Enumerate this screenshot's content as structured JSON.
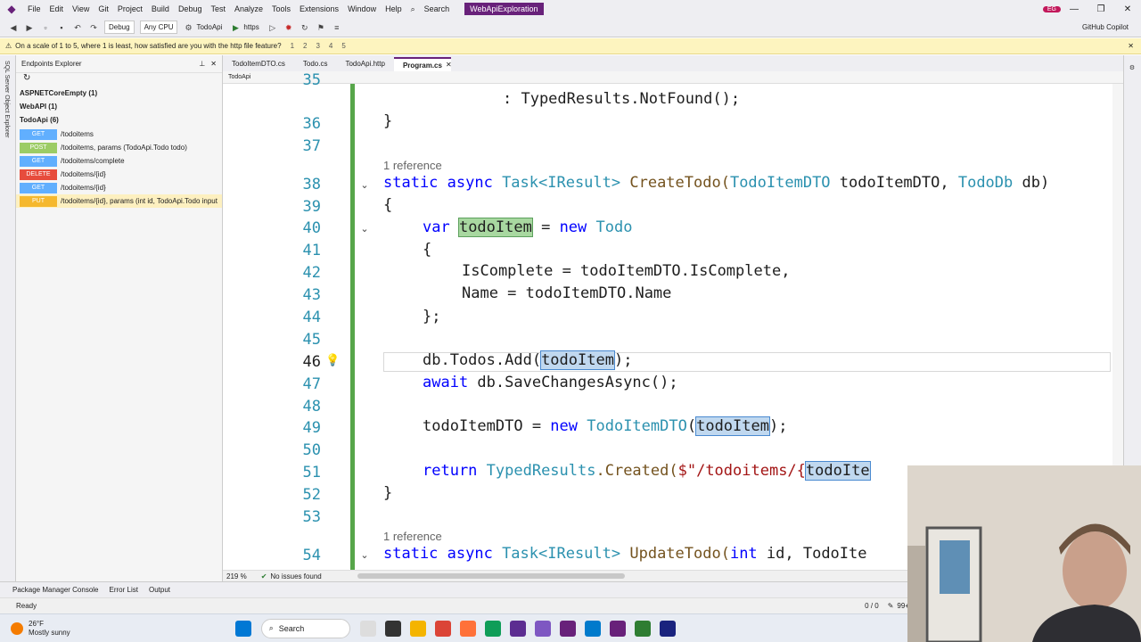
{
  "menu": {
    "items": [
      "File",
      "Edit",
      "View",
      "Git",
      "Project",
      "Build",
      "Debug",
      "Test",
      "Analyze",
      "Tools",
      "Extensions",
      "Window",
      "Help"
    ],
    "search": "Search",
    "solution_title": "WebApiExploration",
    "user_initials": "EG"
  },
  "toolbar": {
    "config": "Debug",
    "platform": "Any CPU",
    "startup_project": "TodoApi",
    "run_target": "https",
    "copilot": "GitHub Copilot"
  },
  "infobar": {
    "message": "On a scale of 1 to 5, where 1 is least, how satisfied are you with the http file feature?",
    "ratings": [
      "1",
      "2",
      "3",
      "4",
      "5"
    ]
  },
  "sidestrip": {
    "label": "SQL Server Object Explorer"
  },
  "explorer": {
    "title": "Endpoints Explorer",
    "groups": [
      "ASPNETCoreEmpty (1)",
      "WebAPI (1)",
      "TodoApi (6)"
    ],
    "endpoints": [
      {
        "verb": "GET",
        "path": "/todoitems"
      },
      {
        "verb": "POST",
        "path": "/todoitems, params (TodoApi.Todo todo)"
      },
      {
        "verb": "GET",
        "path": "/todoitems/complete"
      },
      {
        "verb": "DELETE",
        "path": "/todoitems/{id}"
      },
      {
        "verb": "GET",
        "path": "/todoitems/{id}"
      },
      {
        "verb": "PUT",
        "path": "/todoitems/{id}, params (int id, TodoApi.Todo input"
      }
    ]
  },
  "tabs": [
    "TodoItemDTO.cs",
    "Todo.cs",
    "TodoApi.http",
    "Program.cs"
  ],
  "active_tab": "Program.cs",
  "navbar": {
    "project": "TodoApi"
  },
  "editor": {
    "line_numbers": [
      "35",
      "36",
      "37",
      "38",
      "39",
      "40",
      "41",
      "42",
      "43",
      "44",
      "45",
      "46",
      "47",
      "48",
      "49",
      "50",
      "51",
      "52",
      "53",
      "54"
    ],
    "current_line": "46",
    "references": [
      "1 reference",
      "1 reference"
    ],
    "lines": {
      "l35": ": TypedResults.NotFound();",
      "l36": "}",
      "l38_kw": "static async ",
      "l38_type": "Task<IResult>",
      "l38_fn": " CreateTodo(",
      "l38_p1t": "TodoItemDTO",
      "l38_p1": " todoItemDTO, ",
      "l38_p2t": "TodoDb",
      "l38_p2": " db)",
      "l39": "{",
      "l40_kw": "var ",
      "l40_var": "todoItem",
      "l40_eq": " = ",
      "l40_new": "new ",
      "l40_type": "Todo",
      "l41": "{",
      "l42": "IsComplete = todoItemDTO.IsComplete,",
      "l43": "Name = todoItemDTO.Name",
      "l44": "};",
      "l46_pre": "db.Todos.Add(",
      "l46_var": "todoItem",
      "l46_post": ");",
      "l47_kw": "await ",
      "l47_rest": "db.SaveChangesAsync();",
      "l49_pre": "todoItemDTO = ",
      "l49_new": "new ",
      "l49_type": "TodoItemDTO",
      "l49_open": "(",
      "l49_var": "todoItem",
      "l49_post": ");",
      "l51_kw": "return ",
      "l51_type": "TypedResults",
      "l51_fn": ".Created(",
      "l51_str": "$\"/todoitems/{",
      "l51_var": "todoIte",
      "l52": "}",
      "l54_kw": "static async ",
      "l54_type": "Task<IResult>",
      "l54_fn": " UpdateTodo(",
      "l54_int": "int",
      "l54_rest": " id, TodoIte"
    }
  },
  "hscroll": {
    "zoom": "219 %",
    "issues": "No issues found"
  },
  "bottom_tabs": [
    "Package Manager Console",
    "Error List",
    "Output"
  ],
  "status": {
    "text": "Ready",
    "position": "0 / 0",
    "pencil_count": "99+"
  },
  "taskbar": {
    "temp": "26°F",
    "weather": "Mostly sunny",
    "search": "Search"
  },
  "colors": {
    "accent": "#68217a",
    "keyword": "#0000ff",
    "type": "#2b91af",
    "change_bar": "#57a64a"
  }
}
